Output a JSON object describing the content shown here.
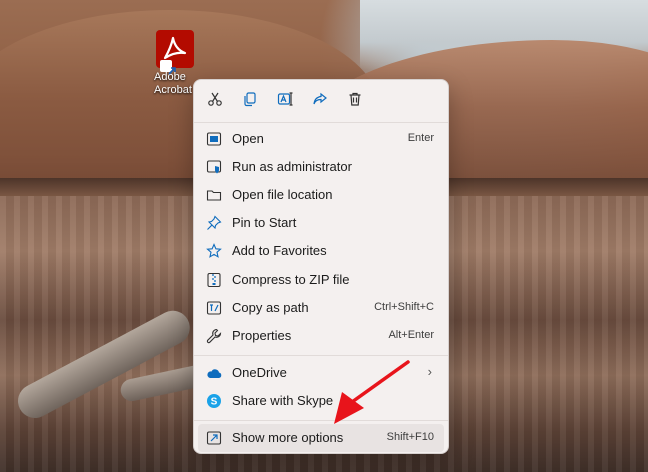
{
  "desktop": {
    "icon_label": "Adobe\nAcrobat"
  },
  "context_menu": {
    "toolbar": [
      {
        "name": "cut-icon"
      },
      {
        "name": "copy-icon"
      },
      {
        "name": "rename-icon"
      },
      {
        "name": "share-icon"
      },
      {
        "name": "delete-icon"
      }
    ],
    "items": [
      {
        "label": "Open",
        "shortcut": "Enter",
        "icon": "open-icon"
      },
      {
        "label": "Run as administrator",
        "shortcut": "",
        "icon": "shield-icon"
      },
      {
        "label": "Open file location",
        "shortcut": "",
        "icon": "folder-icon"
      },
      {
        "label": "Pin to Start",
        "shortcut": "",
        "icon": "pin-icon"
      },
      {
        "label": "Add to Favorites",
        "shortcut": "",
        "icon": "star-icon"
      },
      {
        "label": "Compress to ZIP file",
        "shortcut": "",
        "icon": "zip-icon"
      },
      {
        "label": "Copy as path",
        "shortcut": "Ctrl+Shift+C",
        "icon": "path-icon"
      },
      {
        "label": "Properties",
        "shortcut": "Alt+Enter",
        "icon": "wrench-icon"
      },
      {
        "label": "OneDrive",
        "shortcut": "",
        "icon": "cloud-icon"
      },
      {
        "label": "Share with Skype",
        "shortcut": "",
        "icon": "skype-icon"
      },
      {
        "label": "Show more options",
        "shortcut": "Shift+F10",
        "icon": "more-options-icon"
      }
    ],
    "onedrive_chevron": "›"
  },
  "colors": {
    "acrobat_red": "#b30b00",
    "annotation_arrow": "#e8141b",
    "onedrive_blue": "#0f6cbd",
    "skype_blue": "#1aa2e8"
  }
}
